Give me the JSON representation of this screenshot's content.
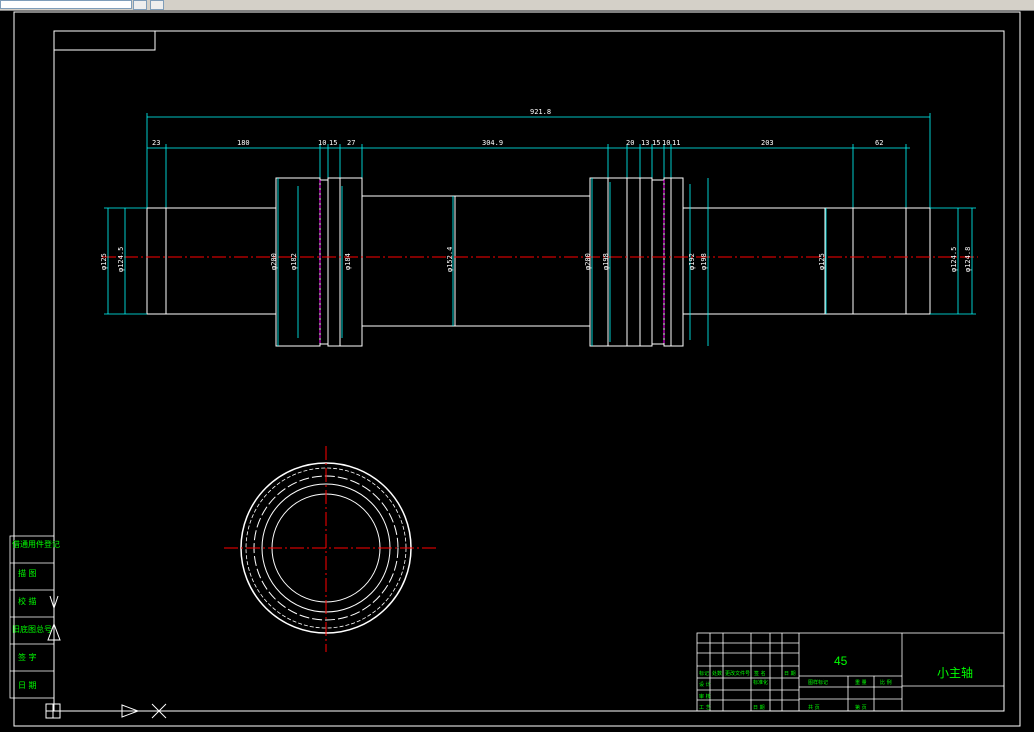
{
  "toolbar": {
    "search_value": "",
    "icons": [
      "dropdown-icon",
      "close-icon"
    ]
  },
  "drawing": {
    "material": "45",
    "part_name": "小主轴",
    "overall_length": "921.8",
    "top_dims": [
      "23",
      "180",
      "10",
      "15",
      "27",
      "304.9",
      "20",
      "13",
      "15",
      "10",
      "11",
      "203",
      "62"
    ],
    "diameters": [
      "φ125",
      "φ124.5",
      "φ200",
      "φ182",
      "φ184",
      "φ152.4",
      "φ200",
      "φ198",
      "φ192",
      "φ198",
      "φ125",
      "φ124.5",
      "φ124.8"
    ]
  },
  "left_stamp": {
    "rows": [
      "借通用件登记",
      "描 图",
      "校 描",
      "旧底图总号",
      "签 字",
      "日 期"
    ]
  },
  "title_block": {
    "labels": [
      "标记",
      "处数",
      "更改文件号",
      "签 名",
      "日 期",
      "设 计",
      "标准化",
      "审 核",
      "工 艺",
      "日 期",
      "图样标记",
      "重 量",
      "比 例",
      "共 页",
      "第 页"
    ]
  },
  "colors": {
    "frame": "#ffffff",
    "centerline": "#ff0000",
    "dimension": "#00ffff",
    "text_green": "#00ff00",
    "hidden": "#ff00ff"
  }
}
